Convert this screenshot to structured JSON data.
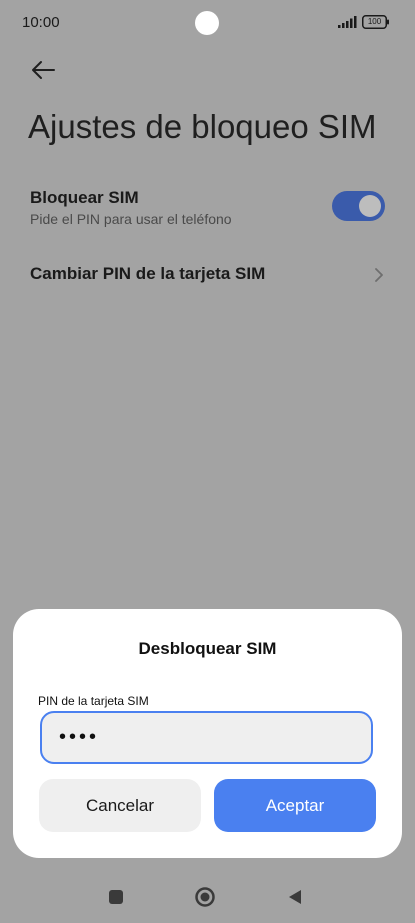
{
  "status_bar": {
    "time": "10:00",
    "battery": "100"
  },
  "page": {
    "title": "Ajustes de bloqueo SIM"
  },
  "settings": {
    "lock_sim": {
      "title": "Bloquear SIM",
      "subtitle": "Pide el PIN para usar el teléfono",
      "enabled": true
    },
    "change_pin": {
      "title": "Cambiar PIN de la tarjeta SIM"
    }
  },
  "dialog": {
    "title": "Desbloquear SIM",
    "field_label": "PIN de la tarjeta SIM",
    "pin_masked": "••••",
    "cancel_label": "Cancelar",
    "accept_label": "Aceptar"
  },
  "colors": {
    "accent": "#4a80f0",
    "toggle_on": "#3a5bab",
    "scrim_background": "#a3a3a3",
    "dialog_background": "#ffffff"
  },
  "icons": {
    "back": "arrow-left-icon",
    "chevron": "chevron-right-icon",
    "nav_recents": "square-icon",
    "nav_home": "circle-icon",
    "nav_back": "triangle-left-icon"
  }
}
